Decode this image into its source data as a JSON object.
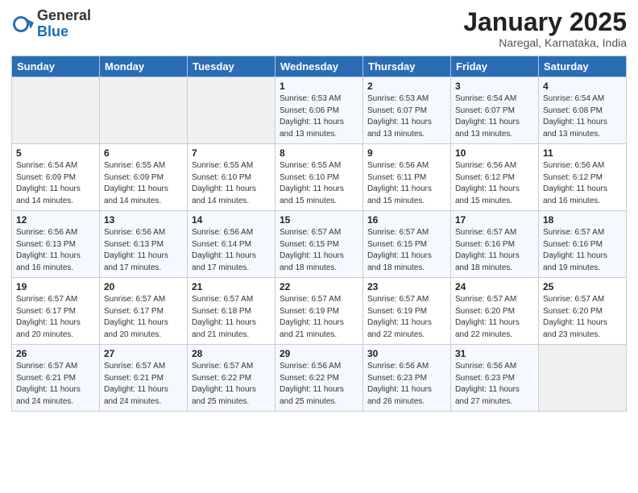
{
  "logo": {
    "general": "General",
    "blue": "Blue"
  },
  "title": "January 2025",
  "subtitle": "Naregal, Karnataka, India",
  "days_of_week": [
    "Sunday",
    "Monday",
    "Tuesday",
    "Wednesday",
    "Thursday",
    "Friday",
    "Saturday"
  ],
  "weeks": [
    [
      {
        "day": "",
        "sunrise": "",
        "sunset": "",
        "daylight": ""
      },
      {
        "day": "",
        "sunrise": "",
        "sunset": "",
        "daylight": ""
      },
      {
        "day": "",
        "sunrise": "",
        "sunset": "",
        "daylight": ""
      },
      {
        "day": "1",
        "sunrise": "Sunrise: 6:53 AM",
        "sunset": "Sunset: 6:06 PM",
        "daylight": "Daylight: 11 hours and 13 minutes."
      },
      {
        "day": "2",
        "sunrise": "Sunrise: 6:53 AM",
        "sunset": "Sunset: 6:07 PM",
        "daylight": "Daylight: 11 hours and 13 minutes."
      },
      {
        "day": "3",
        "sunrise": "Sunrise: 6:54 AM",
        "sunset": "Sunset: 6:07 PM",
        "daylight": "Daylight: 11 hours and 13 minutes."
      },
      {
        "day": "4",
        "sunrise": "Sunrise: 6:54 AM",
        "sunset": "Sunset: 6:08 PM",
        "daylight": "Daylight: 11 hours and 13 minutes."
      }
    ],
    [
      {
        "day": "5",
        "sunrise": "Sunrise: 6:54 AM",
        "sunset": "Sunset: 6:09 PM",
        "daylight": "Daylight: 11 hours and 14 minutes."
      },
      {
        "day": "6",
        "sunrise": "Sunrise: 6:55 AM",
        "sunset": "Sunset: 6:09 PM",
        "daylight": "Daylight: 11 hours and 14 minutes."
      },
      {
        "day": "7",
        "sunrise": "Sunrise: 6:55 AM",
        "sunset": "Sunset: 6:10 PM",
        "daylight": "Daylight: 11 hours and 14 minutes."
      },
      {
        "day": "8",
        "sunrise": "Sunrise: 6:55 AM",
        "sunset": "Sunset: 6:10 PM",
        "daylight": "Daylight: 11 hours and 15 minutes."
      },
      {
        "day": "9",
        "sunrise": "Sunrise: 6:56 AM",
        "sunset": "Sunset: 6:11 PM",
        "daylight": "Daylight: 11 hours and 15 minutes."
      },
      {
        "day": "10",
        "sunrise": "Sunrise: 6:56 AM",
        "sunset": "Sunset: 6:12 PM",
        "daylight": "Daylight: 11 hours and 15 minutes."
      },
      {
        "day": "11",
        "sunrise": "Sunrise: 6:56 AM",
        "sunset": "Sunset: 6:12 PM",
        "daylight": "Daylight: 11 hours and 16 minutes."
      }
    ],
    [
      {
        "day": "12",
        "sunrise": "Sunrise: 6:56 AM",
        "sunset": "Sunset: 6:13 PM",
        "daylight": "Daylight: 11 hours and 16 minutes."
      },
      {
        "day": "13",
        "sunrise": "Sunrise: 6:56 AM",
        "sunset": "Sunset: 6:13 PM",
        "daylight": "Daylight: 11 hours and 17 minutes."
      },
      {
        "day": "14",
        "sunrise": "Sunrise: 6:56 AM",
        "sunset": "Sunset: 6:14 PM",
        "daylight": "Daylight: 11 hours and 17 minutes."
      },
      {
        "day": "15",
        "sunrise": "Sunrise: 6:57 AM",
        "sunset": "Sunset: 6:15 PM",
        "daylight": "Daylight: 11 hours and 18 minutes."
      },
      {
        "day": "16",
        "sunrise": "Sunrise: 6:57 AM",
        "sunset": "Sunset: 6:15 PM",
        "daylight": "Daylight: 11 hours and 18 minutes."
      },
      {
        "day": "17",
        "sunrise": "Sunrise: 6:57 AM",
        "sunset": "Sunset: 6:16 PM",
        "daylight": "Daylight: 11 hours and 18 minutes."
      },
      {
        "day": "18",
        "sunrise": "Sunrise: 6:57 AM",
        "sunset": "Sunset: 6:16 PM",
        "daylight": "Daylight: 11 hours and 19 minutes."
      }
    ],
    [
      {
        "day": "19",
        "sunrise": "Sunrise: 6:57 AM",
        "sunset": "Sunset: 6:17 PM",
        "daylight": "Daylight: 11 hours and 20 minutes."
      },
      {
        "day": "20",
        "sunrise": "Sunrise: 6:57 AM",
        "sunset": "Sunset: 6:17 PM",
        "daylight": "Daylight: 11 hours and 20 minutes."
      },
      {
        "day": "21",
        "sunrise": "Sunrise: 6:57 AM",
        "sunset": "Sunset: 6:18 PM",
        "daylight": "Daylight: 11 hours and 21 minutes."
      },
      {
        "day": "22",
        "sunrise": "Sunrise: 6:57 AM",
        "sunset": "Sunset: 6:19 PM",
        "daylight": "Daylight: 11 hours and 21 minutes."
      },
      {
        "day": "23",
        "sunrise": "Sunrise: 6:57 AM",
        "sunset": "Sunset: 6:19 PM",
        "daylight": "Daylight: 11 hours and 22 minutes."
      },
      {
        "day": "24",
        "sunrise": "Sunrise: 6:57 AM",
        "sunset": "Sunset: 6:20 PM",
        "daylight": "Daylight: 11 hours and 22 minutes."
      },
      {
        "day": "25",
        "sunrise": "Sunrise: 6:57 AM",
        "sunset": "Sunset: 6:20 PM",
        "daylight": "Daylight: 11 hours and 23 minutes."
      }
    ],
    [
      {
        "day": "26",
        "sunrise": "Sunrise: 6:57 AM",
        "sunset": "Sunset: 6:21 PM",
        "daylight": "Daylight: 11 hours and 24 minutes."
      },
      {
        "day": "27",
        "sunrise": "Sunrise: 6:57 AM",
        "sunset": "Sunset: 6:21 PM",
        "daylight": "Daylight: 11 hours and 24 minutes."
      },
      {
        "day": "28",
        "sunrise": "Sunrise: 6:57 AM",
        "sunset": "Sunset: 6:22 PM",
        "daylight": "Daylight: 11 hours and 25 minutes."
      },
      {
        "day": "29",
        "sunrise": "Sunrise: 6:56 AM",
        "sunset": "Sunset: 6:22 PM",
        "daylight": "Daylight: 11 hours and 25 minutes."
      },
      {
        "day": "30",
        "sunrise": "Sunrise: 6:56 AM",
        "sunset": "Sunset: 6:23 PM",
        "daylight": "Daylight: 11 hours and 26 minutes."
      },
      {
        "day": "31",
        "sunrise": "Sunrise: 6:56 AM",
        "sunset": "Sunset: 6:23 PM",
        "daylight": "Daylight: 11 hours and 27 minutes."
      },
      {
        "day": "",
        "sunrise": "",
        "sunset": "",
        "daylight": ""
      }
    ]
  ]
}
